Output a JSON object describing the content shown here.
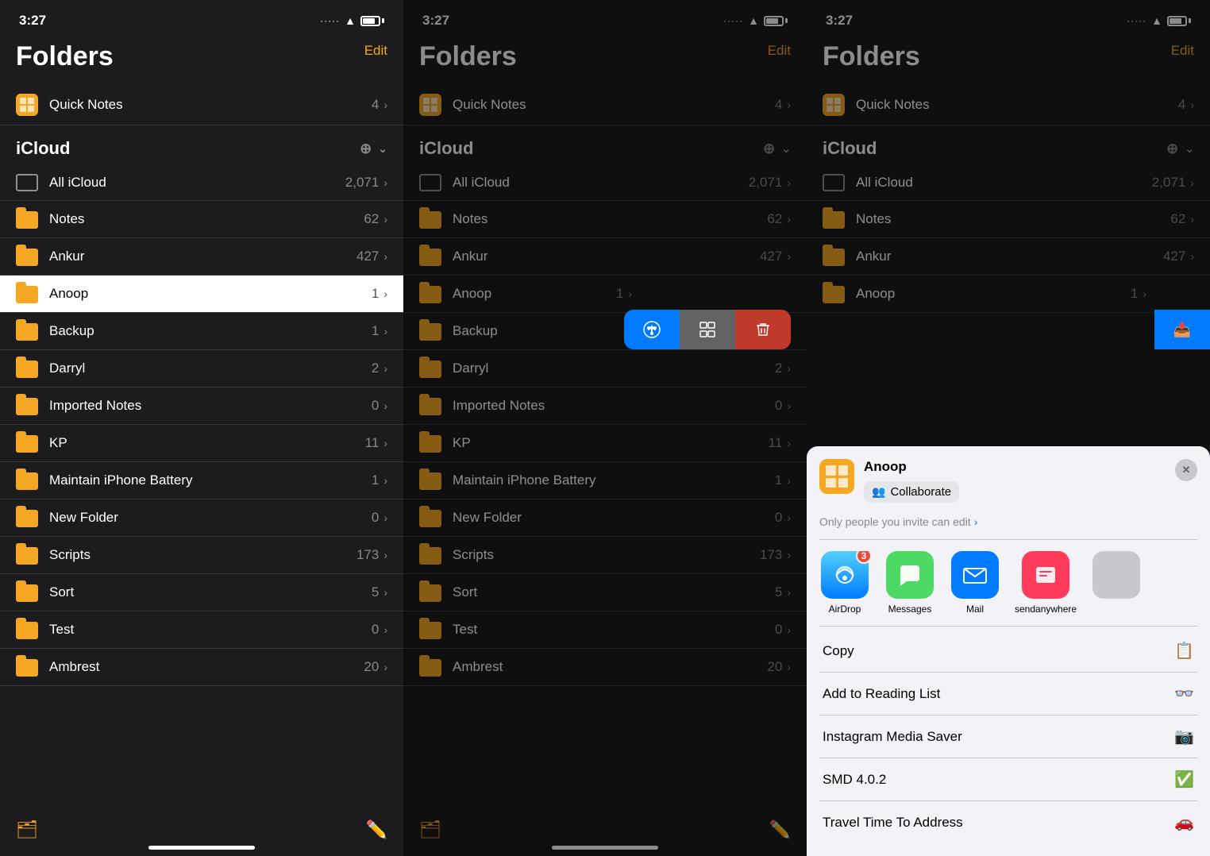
{
  "app": {
    "title": "Folders",
    "edit_label": "Edit",
    "status_time": "3:27"
  },
  "icloud_section": {
    "label": "iCloud",
    "folders": [
      {
        "name": "All iCloud",
        "count": "2,071",
        "type": "allicloud"
      },
      {
        "name": "Notes",
        "count": "62",
        "type": "folder"
      },
      {
        "name": "Ankur",
        "count": "427",
        "type": "folder"
      },
      {
        "name": "Anoop",
        "count": "1",
        "type": "folder",
        "selected": true
      },
      {
        "name": "Backup",
        "count": "1",
        "type": "folder"
      },
      {
        "name": "Darryl",
        "count": "2",
        "type": "folder"
      },
      {
        "name": "Imported Notes",
        "count": "0",
        "type": "folder"
      },
      {
        "name": "KP",
        "count": "11",
        "type": "folder"
      },
      {
        "name": "Maintain iPhone Battery",
        "count": "1",
        "type": "folder"
      },
      {
        "name": "New Folder",
        "count": "0",
        "type": "folder"
      },
      {
        "name": "Scripts",
        "count": "173",
        "type": "folder"
      },
      {
        "name": "Sort",
        "count": "5",
        "type": "folder"
      },
      {
        "name": "Test",
        "count": "0",
        "type": "folder"
      },
      {
        "name": "Ambrest",
        "count": "20",
        "type": "folder"
      }
    ]
  },
  "quicknotes": {
    "name": "Quick Notes",
    "count": "4"
  },
  "panel2": {
    "swipe_share_label": "share",
    "swipe_move_label": "move",
    "swipe_delete_label": "delete"
  },
  "panel3": {
    "share_sheet": {
      "folder_name": "Anoop",
      "collaborate_label": "Collaborate",
      "invite_text": "Only people you invite can edit",
      "apps": [
        {
          "name": "AirDrop",
          "badge": "3",
          "color_class": "airdrop-icon"
        },
        {
          "name": "Messages",
          "badge": null,
          "color_class": "messages-icon"
        },
        {
          "name": "Mail",
          "badge": null,
          "color_class": "mail-icon"
        },
        {
          "name": "sendanywhere",
          "badge": null,
          "color_class": "sendanywhere-icon"
        }
      ],
      "list_items": [
        {
          "label": "Copy",
          "icon": "📋"
        },
        {
          "label": "Add to Reading List",
          "icon": "👓"
        },
        {
          "label": "Instagram Media Saver",
          "icon": "📷"
        },
        {
          "label": "SMD 4.0.2",
          "icon": "✅"
        },
        {
          "label": "Travel Time To Address",
          "icon": "🚗"
        }
      ]
    }
  }
}
